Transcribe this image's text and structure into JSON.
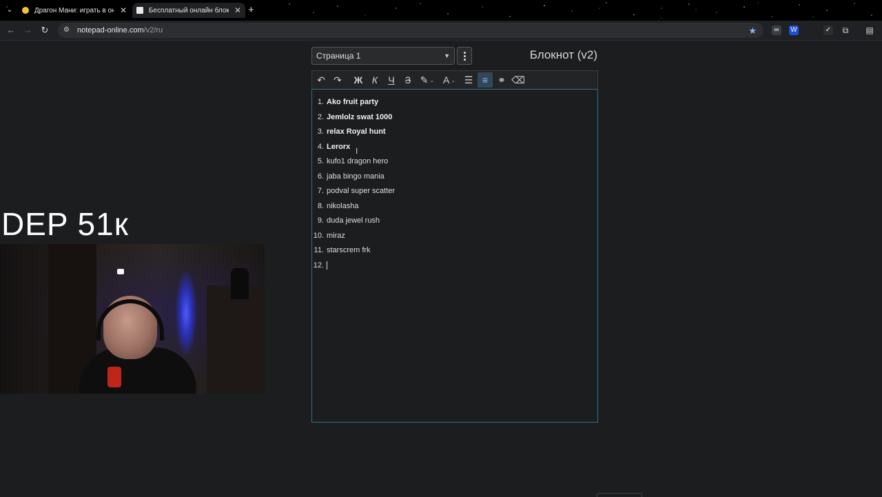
{
  "browser": {
    "tabs": [
      {
        "title": "Драгон Мани: играть в онлайн",
        "active": false
      },
      {
        "title": "Бесплатный онлайн блокнот",
        "active": true
      }
    ],
    "url_host": "notepad-online.com",
    "url_path": "/v2/ru"
  },
  "page": {
    "page_select": "Страница 1",
    "title": "Блокнот (v2)"
  },
  "toolbar": {
    "bold": "Ж",
    "italic": "К",
    "underline": "Ч",
    "strike": "З",
    "font_color": "A"
  },
  "list_items": [
    {
      "n": "1.",
      "text": "Ako fruit party",
      "bold": true
    },
    {
      "n": "2.",
      "text": "Jemlolz swat 1000",
      "bold": true
    },
    {
      "n": "3.",
      "text": "relax Royal hunt",
      "bold": true
    },
    {
      "n": "4.",
      "text": "Lerorx",
      "bold": true
    },
    {
      "n": "5.",
      "text": "kufo1 dragon hero",
      "bold": false
    },
    {
      "n": "6.",
      "text": "jaba bingo mania",
      "bold": false
    },
    {
      "n": "7.",
      "text": "podval super scatter",
      "bold": false
    },
    {
      "n": "8.",
      "text": "nikolasha",
      "bold": false
    },
    {
      "n": "9.",
      "text": "duda jewel rush",
      "bold": false
    },
    {
      "n": "10.",
      "text": "miraz",
      "bold": false
    },
    {
      "n": "11.",
      "text": "starscrem frk",
      "bold": false
    },
    {
      "n": "12.",
      "text": "",
      "bold": false
    }
  ],
  "overlay": {
    "text": "DEP 51к"
  },
  "colors": {
    "accent": "#2f6f8f",
    "background": "#1c1d1f"
  }
}
